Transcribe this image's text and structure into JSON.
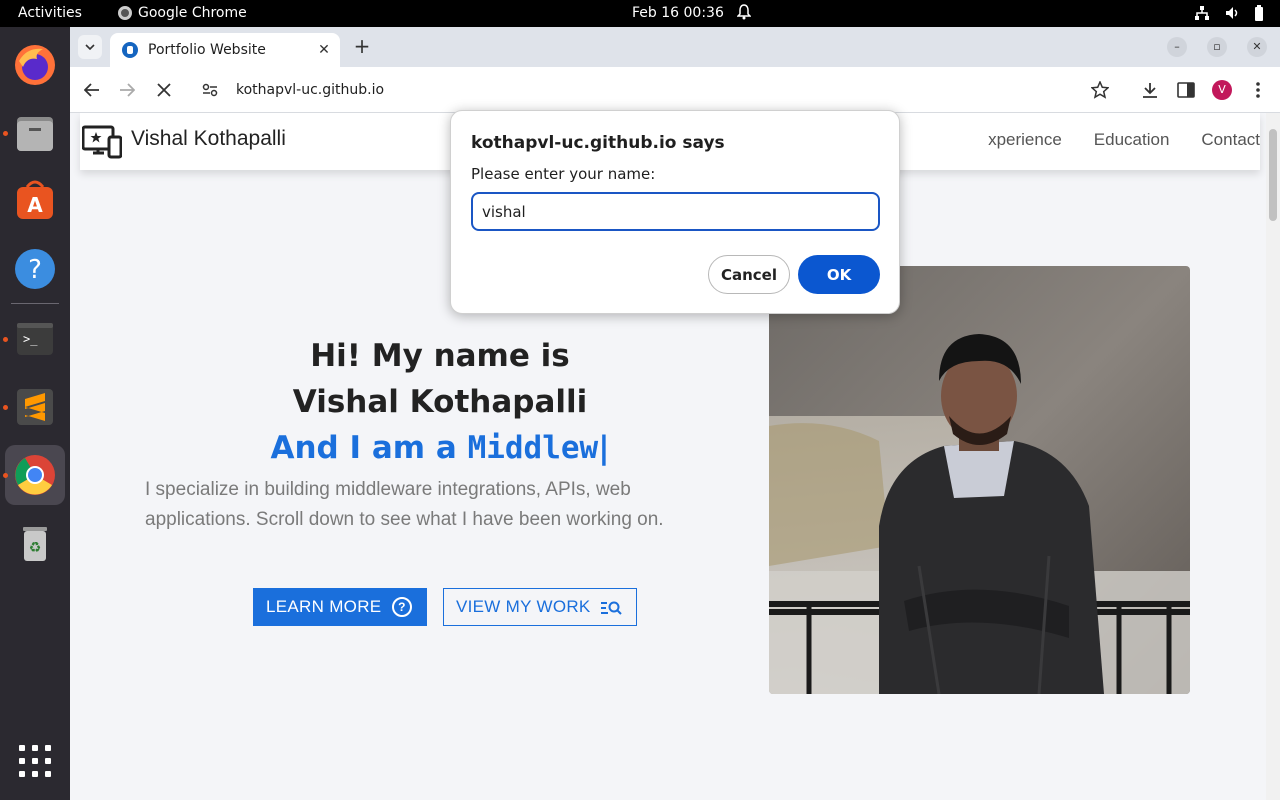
{
  "topbar": {
    "activities": "Activities",
    "app_name": "Google Chrome",
    "clock": "Feb 16  00:36"
  },
  "browser": {
    "tab_title": "Portfolio Website",
    "url": "kothapvl-uc.github.io",
    "profile_initial": "V"
  },
  "site": {
    "brand": "Vishal Kothapalli",
    "nav": [
      "xperience",
      "Education",
      "Contact"
    ],
    "hero": {
      "line1": "Hi! My name is",
      "line2": "Vishal Kothapalli",
      "typed_prefix": "And I am a ",
      "typed_text": "Middlew",
      "description": "I specialize in building middleware integrations, APIs, web applications. Scroll down to see what I have been working on.",
      "learn_more": "LEARN MORE",
      "view_work": "VIEW MY WORK"
    }
  },
  "dialog": {
    "title": "kothapvl-uc.github.io says",
    "message": "Please enter your name:",
    "input_value": "vishal",
    "cancel": "Cancel",
    "ok": "OK"
  },
  "colors": {
    "accent": "#1a6fdc",
    "dialog_button": "#0b57d0",
    "ubuntu_orange": "#e95420"
  }
}
